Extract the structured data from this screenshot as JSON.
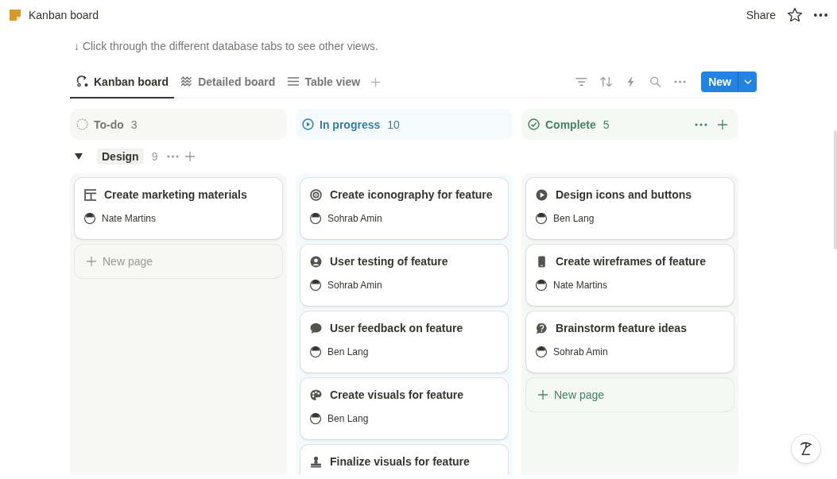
{
  "topbar": {
    "title": "Kanban board",
    "share": "Share"
  },
  "description": "↓ Click through the different database tabs to see other views.",
  "tabs": [
    {
      "label": "Kanban board",
      "selected": true
    },
    {
      "label": "Detailed board",
      "selected": false
    },
    {
      "label": "Table view",
      "selected": false
    }
  ],
  "new_button": "New",
  "columns": [
    {
      "kind": "todo",
      "name": "To-do",
      "count": "3",
      "actions": false,
      "new_page": "New page",
      "cards": [
        {
          "title": "Create marketing materials",
          "assignee": "Nate Martins"
        }
      ]
    },
    {
      "kind": "in_progress",
      "name": "In progress",
      "count": "10",
      "actions": false,
      "cards": [
        {
          "title": "Create iconography for feature",
          "assignee": "Sohrab Amin"
        },
        {
          "title": "User testing of feature",
          "assignee": "Sohrab Amin"
        },
        {
          "title": "User feedback on feature",
          "assignee": "Ben Lang"
        },
        {
          "title": "Create visuals for feature",
          "assignee": "Ben Lang"
        },
        {
          "title": "Finalize visuals for feature"
        }
      ]
    },
    {
      "kind": "complete",
      "name": "Complete",
      "count": "5",
      "actions": true,
      "new_page": "New page",
      "cards": [
        {
          "title": "Design icons and buttons",
          "assignee": "Ben Lang"
        },
        {
          "title": "Create wireframes of feature",
          "assignee": "Nate Martins"
        },
        {
          "title": "Brainstorm feature ideas",
          "assignee": "Sohrab Amin"
        }
      ]
    }
  ],
  "group": {
    "name": "Design",
    "count": "9",
    "expanded": true
  }
}
